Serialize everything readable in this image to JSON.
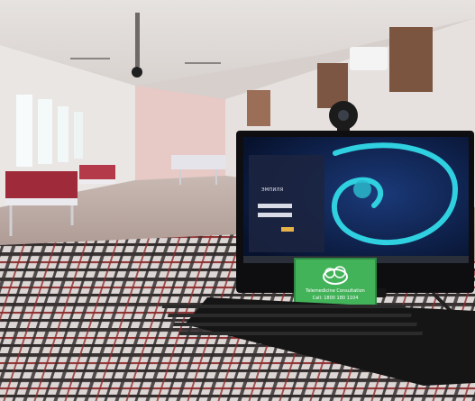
{
  "scene": {
    "description_tags": [
      "hospital-ward",
      "desktop-monitor",
      "webcam",
      "keyboard",
      "plaid-tablecloth",
      "green-sign"
    ]
  },
  "monitor": {
    "screen_title": "ЭМПИЛЯ",
    "wallpaper_color": "#0b1c4a",
    "accent": "#2fd0e0"
  },
  "sign": {
    "color": "#3fae55",
    "lines": [
      "Telemedicine Consultation",
      "Call: 1800 180 1104"
    ]
  },
  "tablecloth": {
    "base": "#d8d2d0",
    "stripe_dark": "#2a2a2a",
    "stripe_red": "#8a2a2a"
  }
}
